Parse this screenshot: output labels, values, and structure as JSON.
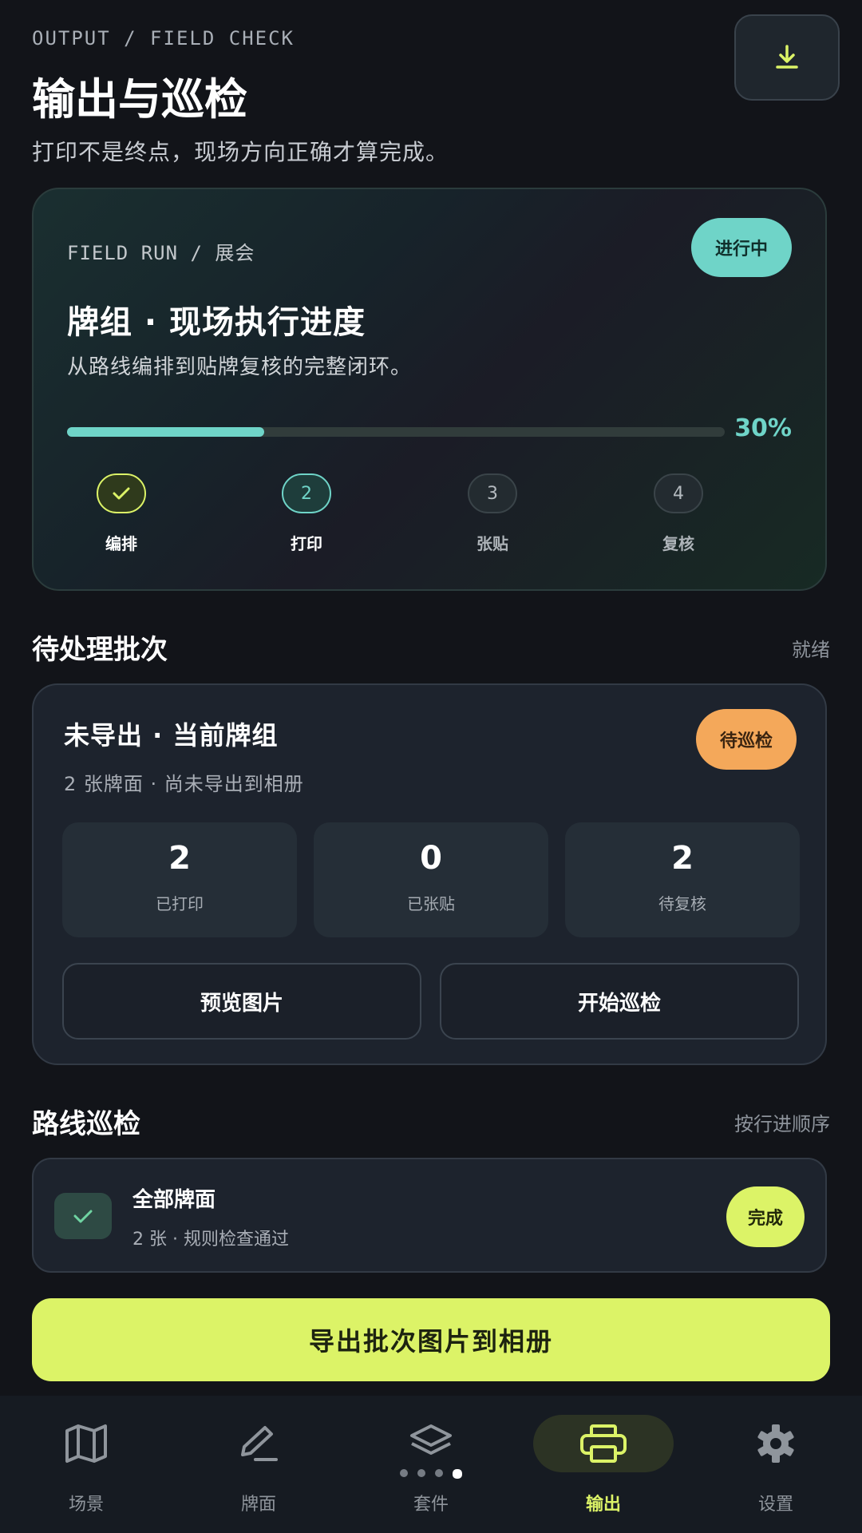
{
  "header": {
    "eyebrow": "OUTPUT / FIELD CHECK",
    "title": "输出与巡检",
    "subtitle": "打印不是终点，现场方向正确才算完成。",
    "download_icon": "download-icon"
  },
  "progress_card": {
    "eyebrow": "FIELD RUN / 展会",
    "badge": "进行中",
    "title": "牌组 · 现场执行进度",
    "description": "从路线编排到贴牌复核的完整闭环。",
    "progress_fraction": 0.3,
    "percent_label": "30%",
    "steps": [
      {
        "number": "",
        "label": "编排",
        "state": "done"
      },
      {
        "number": "2",
        "label": "打印",
        "state": "active"
      },
      {
        "number": "3",
        "label": "张贴",
        "state": "pending"
      },
      {
        "number": "4",
        "label": "复核",
        "state": "pending"
      }
    ],
    "accent_color": "#6fd4c8",
    "done_color": "#dcf367"
  },
  "pending_section": {
    "title": "待处理批次",
    "status": "就绪",
    "card": {
      "title": "未导出 · 当前牌组",
      "subtitle": "2 张牌面 · 尚未导出到相册",
      "badge": "待巡检",
      "badge_color": "#f4a85a",
      "stats": [
        {
          "value": "2",
          "label": "已打印"
        },
        {
          "value": "0",
          "label": "已张贴"
        },
        {
          "value": "2",
          "label": "待复核"
        }
      ],
      "preview_button": "预览图片",
      "start_button": "开始巡检"
    }
  },
  "route_section": {
    "title": "路线巡检",
    "status": "按行进顺序",
    "item": {
      "title": "全部牌面",
      "subtitle": "2 张 · 规则检查通过",
      "badge": "完成"
    }
  },
  "export_button": "导出批次图片到相册",
  "nav": {
    "items": [
      {
        "label": "场景",
        "icon": "map-icon"
      },
      {
        "label": "牌面",
        "icon": "pen-icon"
      },
      {
        "label": "套件",
        "icon": "layers-icon"
      },
      {
        "label": "输出",
        "icon": "printer-icon"
      },
      {
        "label": "设置",
        "icon": "gear-icon"
      }
    ],
    "active_index": 3,
    "active_color": "#dcf367"
  }
}
